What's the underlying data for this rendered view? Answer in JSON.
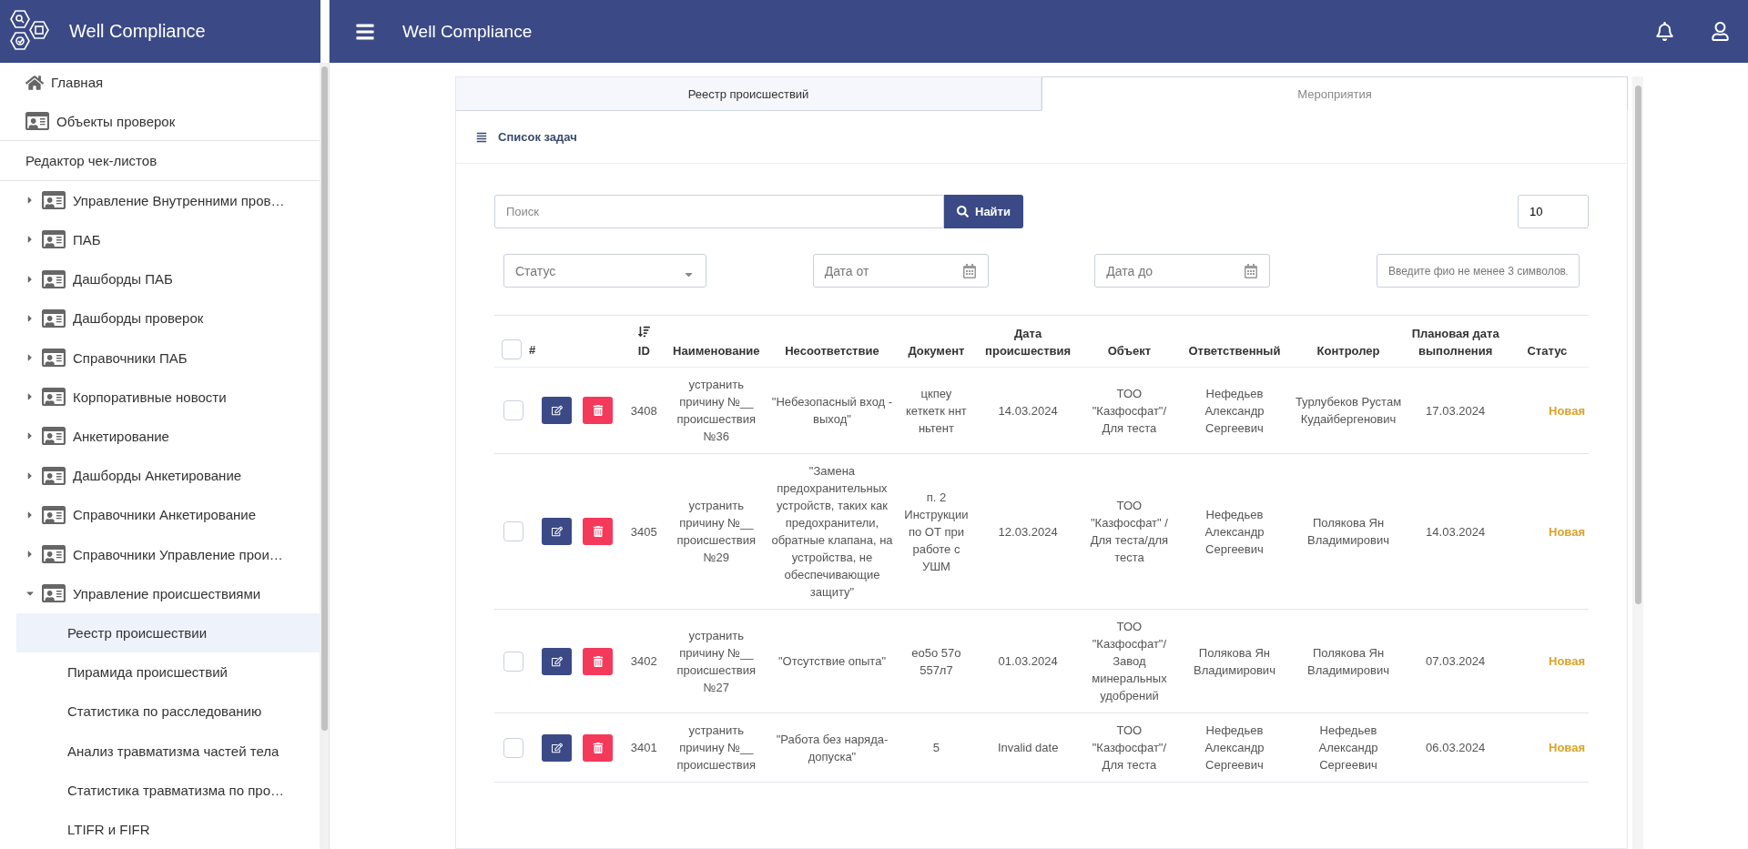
{
  "brand": {
    "name": "Well Compliance"
  },
  "sidebar": {
    "items": [
      {
        "kind": "home",
        "label": "Главная"
      },
      {
        "kind": "page",
        "label": "Объекты проверок"
      },
      {
        "kind": "heading",
        "label": "Редактор чек-листов"
      },
      {
        "kind": "group",
        "label": "Управление Внутренними пров…",
        "expanded": false
      },
      {
        "kind": "group",
        "label": "ПАБ",
        "expanded": false
      },
      {
        "kind": "group",
        "label": "Дашборды ПАБ",
        "expanded": false
      },
      {
        "kind": "group",
        "label": "Дашборды проверок",
        "expanded": false
      },
      {
        "kind": "group",
        "label": "Справочники ПАБ",
        "expanded": false
      },
      {
        "kind": "group",
        "label": "Корпоративные новости",
        "expanded": false
      },
      {
        "kind": "group",
        "label": "Анкетирование",
        "expanded": false
      },
      {
        "kind": "group",
        "label": "Дашборды Анкетирование",
        "expanded": false
      },
      {
        "kind": "group",
        "label": "Справочники Анкетирование",
        "expanded": false
      },
      {
        "kind": "group",
        "label": "Справочники Управление прои…",
        "expanded": false
      },
      {
        "kind": "group",
        "label": "Управление происшествиями",
        "expanded": true,
        "children": [
          {
            "label": "Реестр происшествии",
            "selected": true
          },
          {
            "label": "Пирамида происшествий",
            "selected": false
          },
          {
            "label": "Статистика по расследованию",
            "selected": false
          },
          {
            "label": "Анализ травматизма частей тела",
            "selected": false
          },
          {
            "label": "Статистика травматизма по про…",
            "selected": false
          },
          {
            "label": "LTIFR и FIFR",
            "selected": false
          }
        ]
      }
    ]
  },
  "topbar": {
    "title": "Well Compliance"
  },
  "tabs": [
    {
      "label": "Реестр происшествий",
      "selected": false
    },
    {
      "label": "Мероприятия",
      "selected": true
    }
  ],
  "panel": {
    "title": "Список задач"
  },
  "search": {
    "placeholder": "Поиск",
    "button": "Найти",
    "page_size": "10"
  },
  "filters": [
    {
      "kind": "select",
      "placeholder": "Статус"
    },
    {
      "kind": "date",
      "placeholder": "Дата от"
    },
    {
      "kind": "date",
      "placeholder": "Дата до"
    },
    {
      "kind": "select",
      "placeholder": "Введите фио не менее 3 символов"
    }
  ],
  "table": {
    "all_checked": false,
    "columns": [
      {
        "label": "#",
        "sorted": false
      },
      {
        "label": "ID",
        "sorted": true
      },
      {
        "label": "Наименование",
        "sorted": false
      },
      {
        "label": "Несоответствие",
        "sorted": false
      },
      {
        "label": "Документ",
        "sorted": false
      },
      {
        "label": "Дата происшествия",
        "sorted": false
      },
      {
        "label": "Объект",
        "sorted": false
      },
      {
        "label": "Ответственный",
        "sorted": false
      },
      {
        "label": "Контролер",
        "sorted": false
      },
      {
        "label": "Плановая дата выполнения",
        "sorted": false
      },
      {
        "label": "Статус",
        "sorted": false
      }
    ],
    "rows": [
      {
        "checked": false,
        "id": "3408",
        "name": "устранить причину №__ происшествия №36",
        "issue": "\"Небезопасный вход - выход\"",
        "document": "цкпеу кеткетк ннт ньтент",
        "date": "14.03.2024",
        "object": "ТОО \"Казфосфат\"/ Для теста",
        "responsible": "Нефедьев Александр Сергеевич",
        "controller": "Турлубеков Рустам Кудайбергенович",
        "due": "17.03.2024",
        "status": "Новая",
        "color": "#dba32a"
      },
      {
        "checked": false,
        "id": "3405",
        "name": "устранить причину №__ происшествия №29",
        "issue": "\"Замена предохранительных устройств, таких как предохранители, обратные клапана, на устройства, не обеспечивающие защиту\"",
        "document": "п. 2 Инструкции по ОТ при работе с УШМ",
        "date": "12.03.2024",
        "object": "ТОО \"Казфосфат\" / Для теста/для теста",
        "responsible": "Нефедьев Александр Сергеевич",
        "controller": "Полякова Ян Владимирович",
        "due": "14.03.2024",
        "status": "Новая",
        "color": "#dba32a"
      },
      {
        "checked": false,
        "id": "3402",
        "name": "устранить причину №__ происшествия №27",
        "issue": "\"Отсутствие опыта\"",
        "document": "ео5о 57о 557л7",
        "date": "01.03.2024",
        "object": "ТОО \"Казфосфат\"/ Завод минеральных удобрений",
        "responsible": "Полякова Ян Владимирович",
        "controller": "Полякова Ян Владимирович",
        "due": "07.03.2024",
        "status": "Новая",
        "color": "#dba32a"
      },
      {
        "checked": false,
        "id": "3401",
        "name": "устранить причину №__ происшествия",
        "issue": "\"Работа без наряда-допуска\"",
        "document": "5",
        "date": "Invalid date",
        "object": "ТОО \"Казфосфат\"/ Для теста",
        "responsible": "Нефедьев Александр Сергеевич",
        "controller": "Нефедьев Александр Сергеевич",
        "due": "06.03.2024",
        "status": "Новая",
        "color": "#dba32a"
      }
    ]
  }
}
